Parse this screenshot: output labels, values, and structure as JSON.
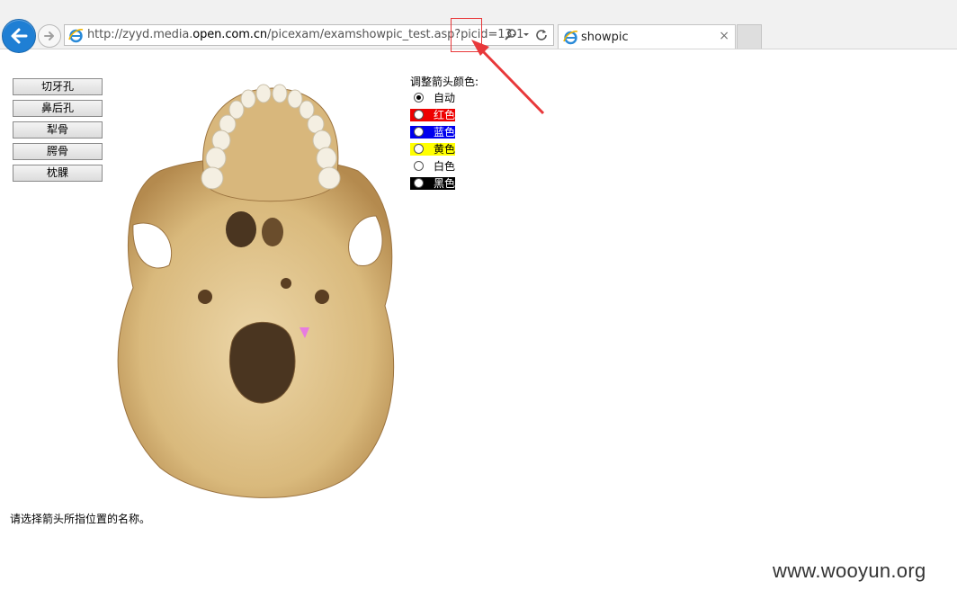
{
  "browser": {
    "url_prefix": "http://zyyd.media.",
    "url_domain": "open.com.cn",
    "url_suffix": "/picexam/examshowpic_test.asp?picid=",
    "url_picid": "13-1",
    "tab_title": "showpic",
    "tab_close": "×"
  },
  "answer_buttons": [
    "切牙孔",
    "鼻后孔",
    "犁骨",
    "腭骨",
    "枕髁"
  ],
  "color_panel": {
    "title": "调整箭头颜色:",
    "options": [
      {
        "label": "自动",
        "checked": true,
        "swatch": null,
        "text_color": "#000000"
      },
      {
        "label": "红色",
        "checked": false,
        "swatch": "#ee0000",
        "text_color": "#ffffff"
      },
      {
        "label": "蓝色",
        "checked": false,
        "swatch": "#0000ee",
        "text_color": "#ffffff"
      },
      {
        "label": "黄色",
        "checked": false,
        "swatch": "#ffff00",
        "text_color": "#000000"
      },
      {
        "label": "白色",
        "checked": false,
        "swatch": null,
        "text_color": "#000000"
      },
      {
        "label": "黑色",
        "checked": false,
        "swatch": "#000000",
        "text_color": "#ffffff"
      }
    ]
  },
  "prompt": "请选择箭头所指位置的名称。",
  "watermark": "www.wooyun.org",
  "colors": {
    "annotation_red": "#e8383a",
    "pointer_arrow": "#e77be0",
    "back_button": "#1f7fd4"
  }
}
